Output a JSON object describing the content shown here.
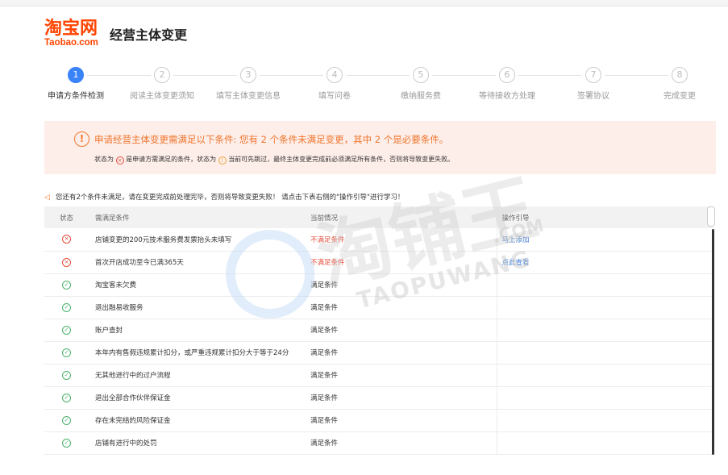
{
  "logo": {
    "cn": "淘宝网",
    "en": "Taobao.com"
  },
  "page_title": "经营主体变更",
  "steps": [
    {
      "num": "1",
      "label": "申请方条件检测",
      "active": true
    },
    {
      "num": "2",
      "label": "阅读主体变更须知",
      "active": false
    },
    {
      "num": "3",
      "label": "填写主体变更信息",
      "active": false
    },
    {
      "num": "4",
      "label": "填写问卷",
      "active": false
    },
    {
      "num": "5",
      "label": "缴纳服务费",
      "active": false
    },
    {
      "num": "6",
      "label": "等待接收方处理",
      "active": false
    },
    {
      "num": "7",
      "label": "签署协议",
      "active": false
    },
    {
      "num": "8",
      "label": "完成变更",
      "active": false
    }
  ],
  "alert": {
    "icon": "info-icon",
    "main": "申请经营主体变更需满足以下条件: 您有 2 个条件未满足变更，其中 2 个是必要条件。",
    "sub_a": "状态为",
    "sub_b": "是申请方需满足的条件，状态为",
    "sub_c": "当前可先跳过，最终主体变更完成前必须满足所有条件，否则将导致变更失败。"
  },
  "notice": "您还有2个条件未满足，请在变更完成前处理完毕，否则将导致变更失败！ 请点击下表右侧的\"操作引导\"进行学习！",
  "table": {
    "headers": {
      "status": "状态",
      "condition": "需满足条件",
      "current": "当前情况",
      "guide": "操作引导"
    },
    "rows": [
      {
        "status": "fail",
        "condition": "店铺变更的200元技术服务费发票抬头未填写",
        "current": "不满足条件",
        "guide": "马上添加"
      },
      {
        "status": "fail",
        "condition": "首次开店成功至今已满365天",
        "current": "不满足条件",
        "guide": "点此查看"
      },
      {
        "status": "ok",
        "condition": "淘宝客未欠费",
        "current": "满足条件",
        "guide": ""
      },
      {
        "status": "ok",
        "condition": "退出融易收服务",
        "current": "满足条件",
        "guide": ""
      },
      {
        "status": "ok",
        "condition": "账户查封",
        "current": "满足条件",
        "guide": ""
      },
      {
        "status": "ok",
        "condition": "本年内有售假违规累计扣分，或严重违规累计扣分大于等于24分",
        "current": "满足条件",
        "guide": ""
      },
      {
        "status": "ok",
        "condition": "无其他进行中的过户流程",
        "current": "满足条件",
        "guide": ""
      },
      {
        "status": "ok",
        "condition": "退出全部合作伙伴保证金",
        "current": "满足条件",
        "guide": ""
      },
      {
        "status": "ok",
        "condition": "存在未完结的风险保证金",
        "current": "满足条件",
        "guide": ""
      },
      {
        "status": "ok",
        "condition": "店铺有进行中的处罚",
        "current": "满足条件",
        "guide": ""
      }
    ]
  },
  "watermark": {
    "cn": "淘铺王",
    "en": "TAOPUWANG",
    "dotcom": ".COM"
  },
  "colors": {
    "accent": "#3a82f7",
    "warning": "#f0762e",
    "error": "#e54b3a",
    "success": "#4bb36a",
    "link": "#3a7bd5"
  }
}
